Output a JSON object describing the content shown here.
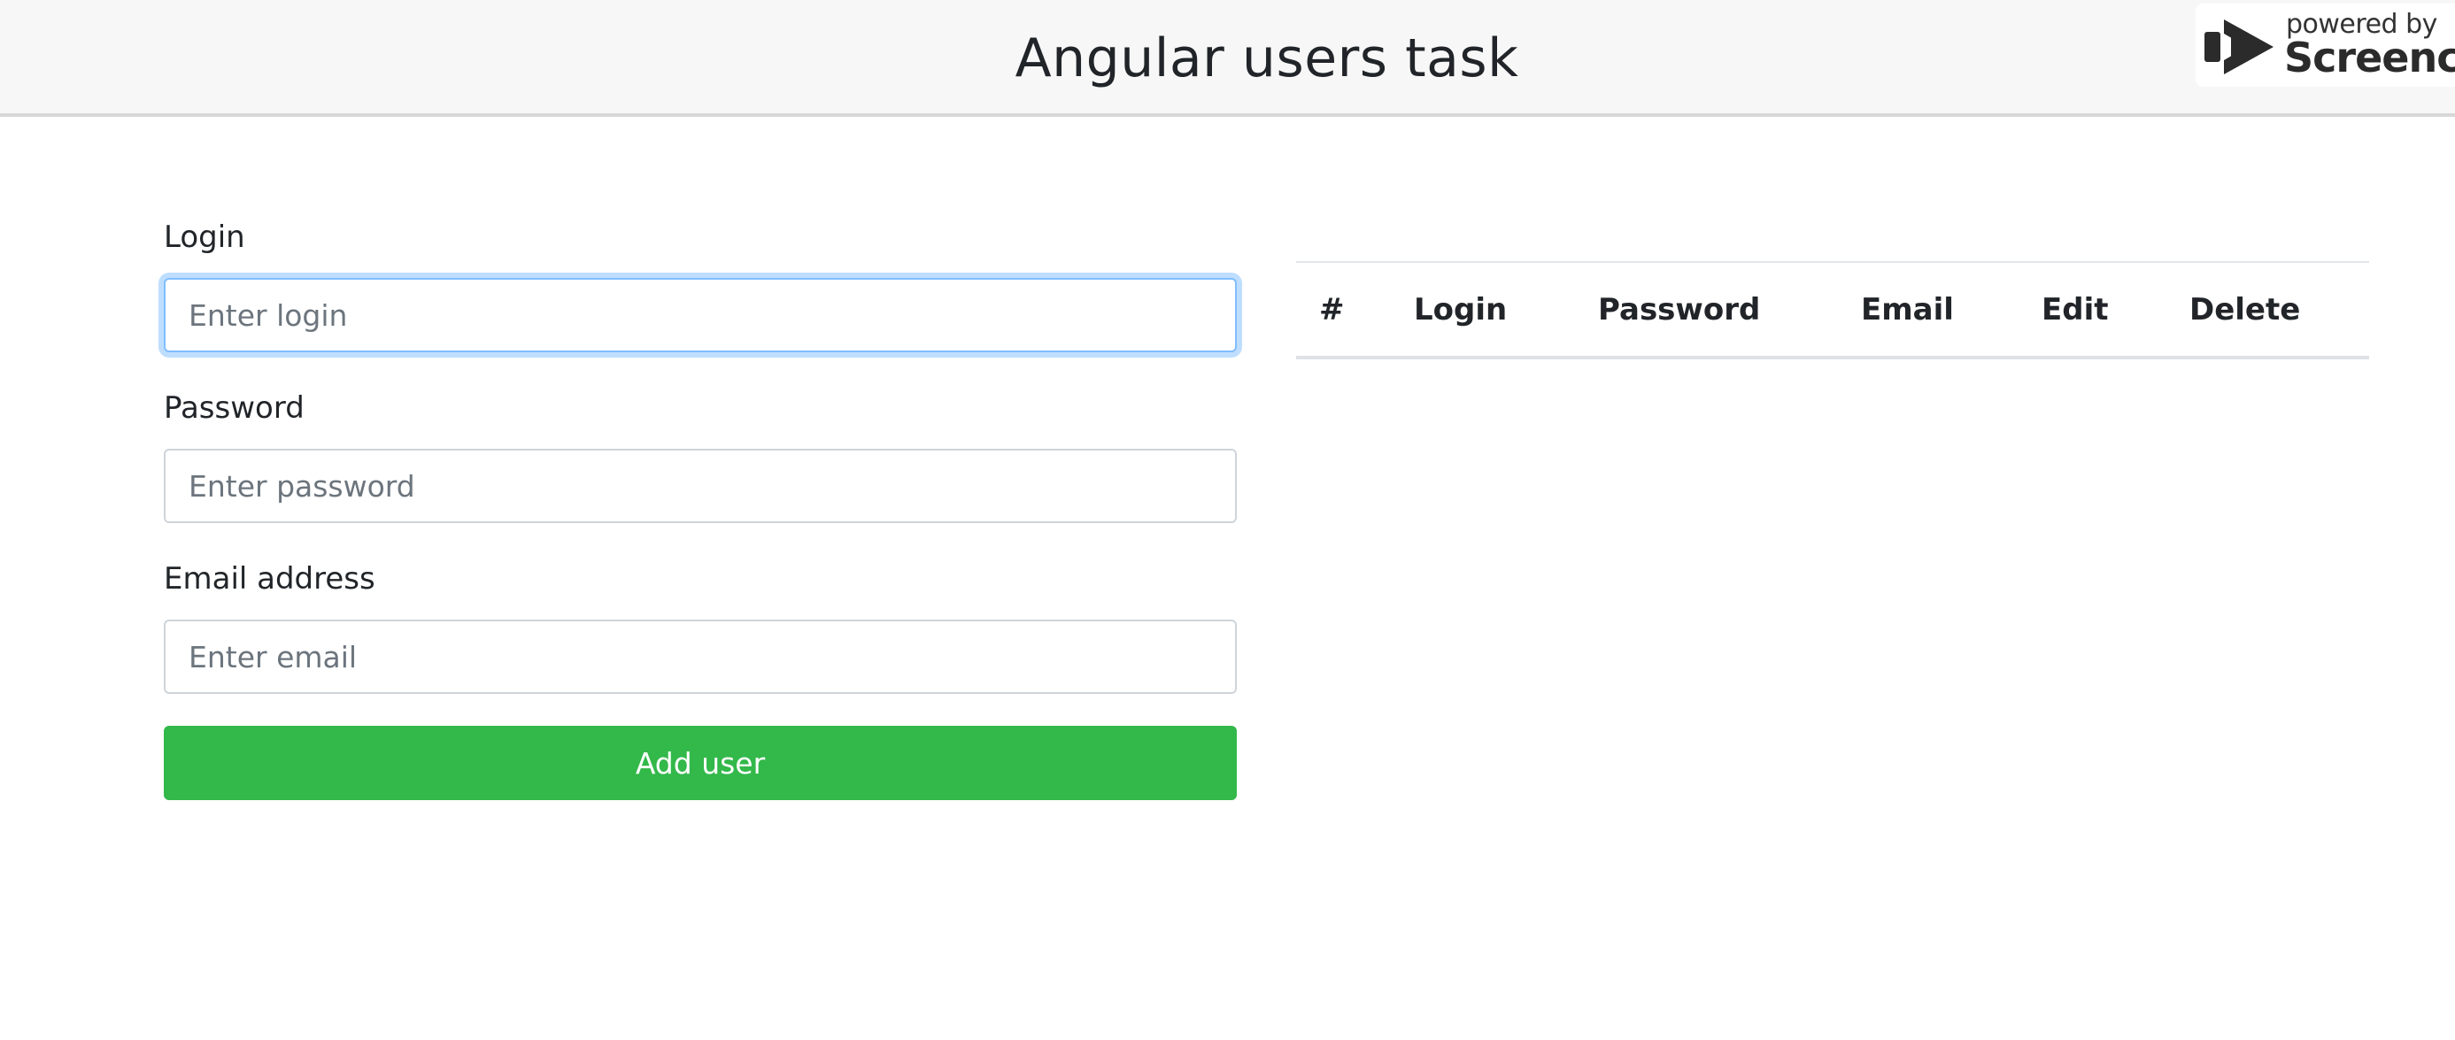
{
  "header": {
    "title": "Angular users task"
  },
  "badge": {
    "powered_by": "powered by",
    "brand": "Screencast",
    "icon": "screencast-logo-icon"
  },
  "form": {
    "login": {
      "label": "Login",
      "placeholder": "Enter login",
      "value": ""
    },
    "password": {
      "label": "Password",
      "placeholder": "Enter password",
      "value": ""
    },
    "email": {
      "label": "Email address",
      "placeholder": "Enter email",
      "value": ""
    },
    "submit_label": "Add user"
  },
  "table": {
    "columns": [
      "#",
      "Login",
      "Password",
      "Email",
      "Edit",
      "Delete"
    ],
    "rows": []
  },
  "colors": {
    "primary_button": "#33b84a",
    "focus_border": "#80bdff",
    "header_bg": "#f7f7f7"
  }
}
